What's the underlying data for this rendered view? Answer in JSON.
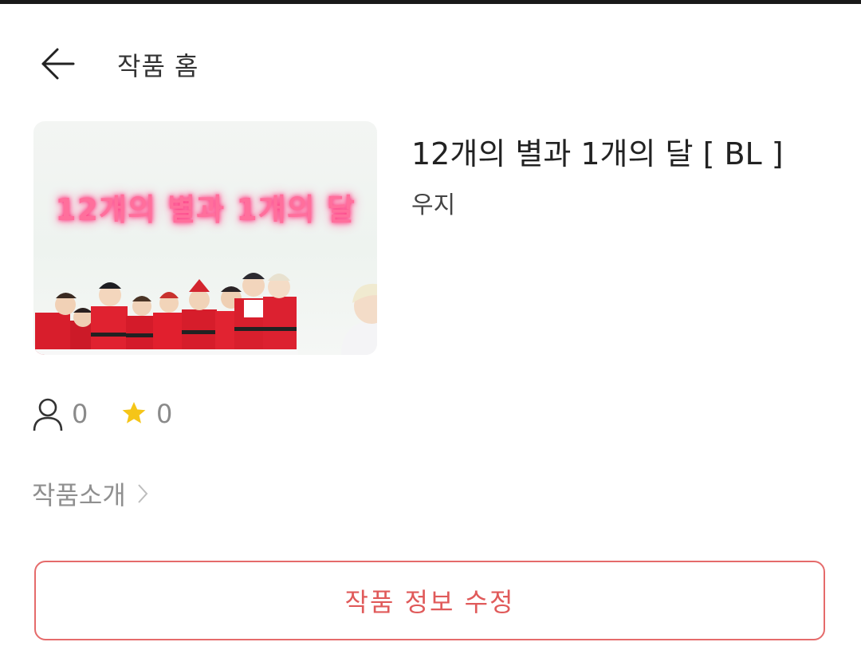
{
  "header": {
    "title": "작품 홈"
  },
  "work": {
    "cover_text": "12개의 별과 1개의 달",
    "title": "12개의 별과 1개의 달 [ BL ]",
    "author": "우지"
  },
  "stats": {
    "readers": "0",
    "stars": "0"
  },
  "intro": {
    "label": "작품소개"
  },
  "actions": {
    "edit_label": "작품 정보 수정"
  },
  "colors": {
    "accent": "#e05a5a",
    "star": "#f5c518",
    "neon_pink": "#ff6f9c"
  },
  "icons": {
    "back": "arrow-left-icon",
    "reader": "person-icon",
    "star": "star-icon",
    "chevron": "chevron-right-icon"
  }
}
